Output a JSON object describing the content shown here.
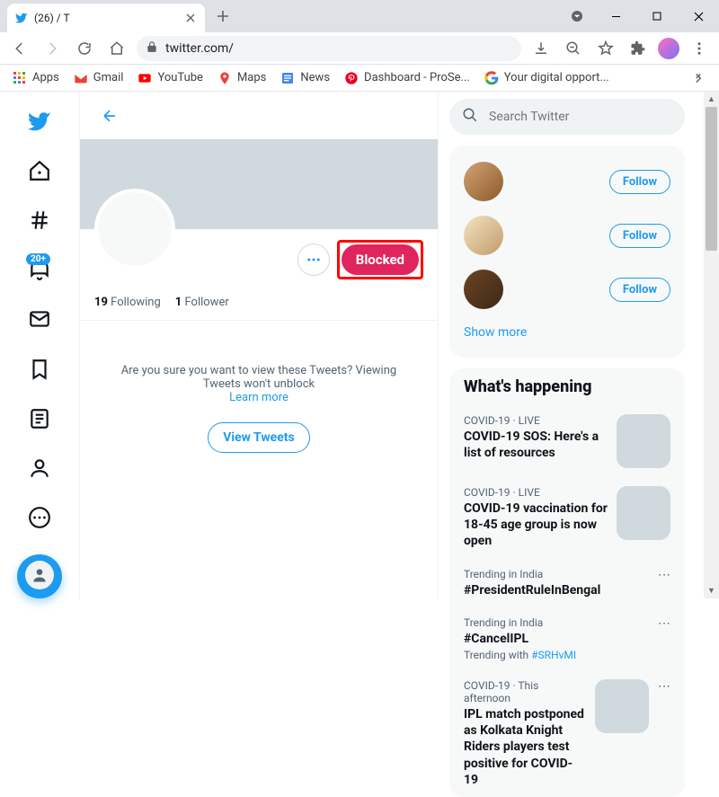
{
  "browser": {
    "tab_title": "(26)                            / T",
    "url": "twitter.com/",
    "bookmarks": {
      "apps": "Apps",
      "gmail": "Gmail",
      "youtube": "YouTube",
      "maps": "Maps",
      "news": "News",
      "dashboard": "Dashboard - ProSe...",
      "digital": "Your digital opport..."
    }
  },
  "twitter": {
    "nav": {
      "badge": "20+"
    },
    "search": {
      "placeholder": "Search Twitter"
    },
    "profile": {
      "blocked_label": "Blocked",
      "following_count": "19",
      "following_label": "Following",
      "followers_count": "1",
      "followers_label": "Follower",
      "blocked_message": "Are you sure you want to view these Tweets? Viewing Tweets won't unblock",
      "learn_more": "Learn more",
      "view_tweets": "View Tweets"
    },
    "suggestions": {
      "follow_label": "Follow",
      "show_more": "Show more"
    },
    "whats_happening": {
      "title": "What's happening",
      "trends": [
        {
          "meta": "COVID-19 · LIVE",
          "title": "COVID-19 SOS: Here's a list of resources",
          "sub": "",
          "thumb": true,
          "more": false
        },
        {
          "meta": "COVID-19 · LIVE",
          "title": "COVID-19 vaccination for 18-45 age group is now open",
          "sub": "",
          "thumb": true,
          "more": false
        },
        {
          "meta": "Trending in India",
          "title": "#PresidentRuleInBengal",
          "sub": "",
          "thumb": false,
          "more": true
        },
        {
          "meta": "Trending in India",
          "title": "#CancelIPL",
          "sub": "Trending with ",
          "sub_hl": "#SRHvMI",
          "thumb": false,
          "more": true
        },
        {
          "meta": "COVID-19 · This afternoon",
          "title": "IPL match postponed as Kolkata Knight Riders players test positive for COVID-19",
          "sub": "",
          "thumb": true,
          "more": true
        }
      ]
    }
  }
}
